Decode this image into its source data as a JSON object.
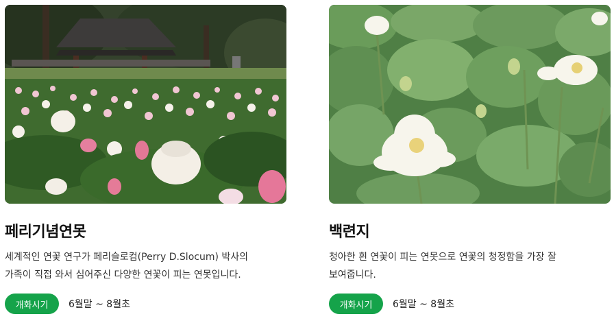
{
  "cards": [
    {
      "photo": "pink-and-white-lotus-pond-with-korean-pavilion",
      "title": "페리기념연못",
      "description_lines": [
        "세계적인 연꽃 연구가 페리슬로컴(Perry D.Slocum) 박사의",
        "가족이 직접 와서 심어주신 다양한 연꽃이 피는 연못입니다."
      ],
      "badge_label": "개화시기",
      "period": "6월말 ~ 8월초"
    },
    {
      "photo": "white-lotus-flowers-among-large-green-leaves",
      "title": "백련지",
      "description_lines": [
        "청아한 흰 연꽃이 피는 연못으로 연꽃의 청정함을 가장 잘",
        "보여줍니다."
      ],
      "badge_label": "개화시기",
      "period": "6월말 ~ 8월초"
    }
  ],
  "colors": {
    "badge_bg": "#15a34a",
    "badge_text": "#ffffff",
    "title_text": "#111111",
    "body_text": "#333333"
  }
}
